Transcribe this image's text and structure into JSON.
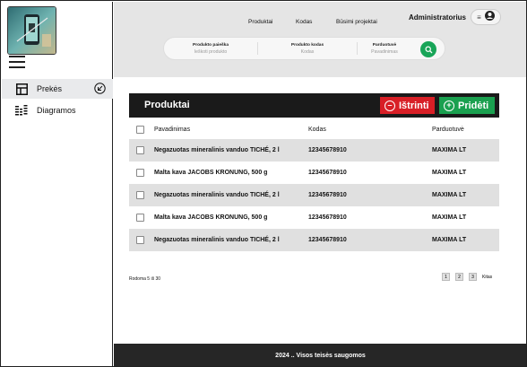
{
  "sidebar": {
    "items": [
      {
        "label": "Prekės",
        "icon": "layout-icon",
        "active": true
      },
      {
        "label": "Diagramos",
        "icon": "bars-icon",
        "active": false
      }
    ]
  },
  "header": {
    "links": [
      "Produktai",
      "Kodas",
      "Būsimi projektai"
    ],
    "user": "Administratorius",
    "search": {
      "fields": [
        {
          "label": "Produkto paieška",
          "placeholder": "Ieškoti produkto"
        },
        {
          "label": "Produkto kodas",
          "placeholder": "Kodas"
        },
        {
          "label": "Parduotuvė",
          "placeholder": "Pavadinimas"
        }
      ]
    }
  },
  "main": {
    "title": "Produktai",
    "delete_label": "Ištrinti",
    "add_label": "Pridėti",
    "columns": [
      "Pavadinimas",
      "Kodas",
      "Parduotuvė"
    ],
    "rows": [
      {
        "name": "Negazuotas mineralinis vanduo TICHÉ, 2 l",
        "code": "12345678910",
        "shop": "MAXIMA LT"
      },
      {
        "name": "Malta kava JACOBS KRONUNG, 500 g",
        "code": "12345678910",
        "shop": "MAXIMA LT"
      },
      {
        "name": "Negazuotas mineralinis vanduo TICHÉ, 2 l",
        "code": "12345678910",
        "shop": "MAXIMA LT"
      },
      {
        "name": "Malta kava JACOBS KRONUNG, 500 g",
        "code": "12345678910",
        "shop": "MAXIMA LT"
      },
      {
        "name": "Negazuotas mineralinis vanduo TICHÉ, 2 l",
        "code": "12345678910",
        "shop": "MAXIMA LT"
      }
    ],
    "showing": "Rodoma 5 iš 30",
    "pages": [
      "1",
      "2",
      "3"
    ],
    "next": "Kitas"
  },
  "footer": {
    "text": "2024 .. Visos teisės saugomos"
  },
  "colors": {
    "accent_green": "#1aa04f",
    "danger_red": "#d81f26",
    "header_bg": "#e5e5e5",
    "footer_bg": "#262626"
  }
}
